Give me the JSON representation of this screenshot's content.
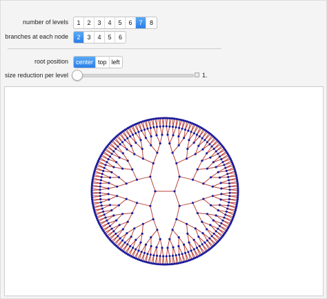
{
  "controls": {
    "levels": {
      "label": "number of levels",
      "options": [
        "1",
        "2",
        "3",
        "4",
        "5",
        "6",
        "7",
        "8"
      ],
      "selected": "7"
    },
    "branches": {
      "label": "branches at each node",
      "options": [
        "2",
        "3",
        "4",
        "5",
        "6"
      ],
      "selected": "2"
    },
    "root_position": {
      "label": "root position",
      "options": [
        "center",
        "top",
        "left"
      ],
      "selected": "center"
    },
    "size_reduction": {
      "label": "size reduction per level",
      "value": "1.",
      "fraction": 0
    }
  },
  "colors": {
    "accent": "#2b7ee8",
    "branch": "#b8413a",
    "node": "#1c1c9c"
  }
}
